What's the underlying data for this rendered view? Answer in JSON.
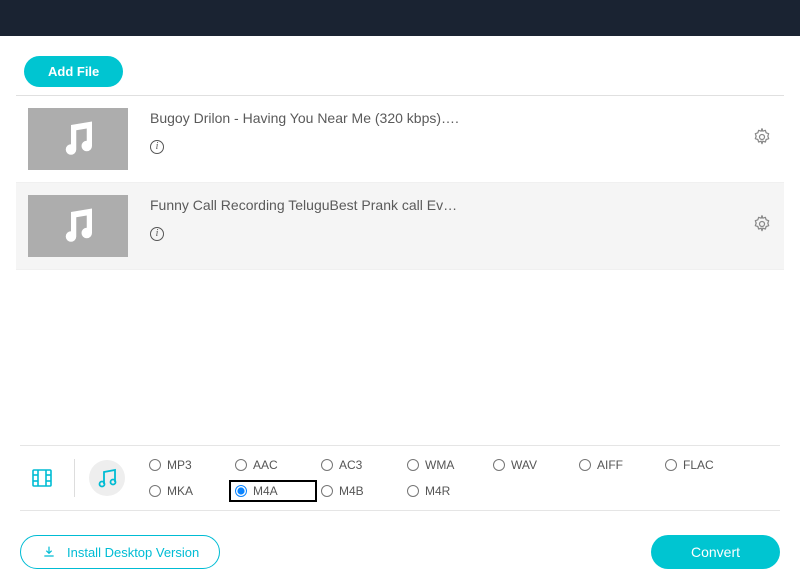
{
  "toolbar": {
    "add_file_label": "Add File"
  },
  "files": [
    {
      "title": "Bugoy Drilon - Having You Near Me (320 kbps)….",
      "selected": false
    },
    {
      "title": "Funny Call Recording TeluguBest Prank call Ev…",
      "selected": true
    }
  ],
  "formats": {
    "row1": [
      "MP3",
      "AAC",
      "AC3",
      "WMA",
      "WAV",
      "AIFF",
      "FLAC"
    ],
    "row2": [
      "MKA",
      "M4A",
      "M4B",
      "M4R"
    ],
    "selected": "M4A",
    "highlighted": "M4A"
  },
  "bottom": {
    "install_label": "Install Desktop Version",
    "convert_label": "Convert"
  },
  "colors": {
    "accent": "#00c5d1"
  }
}
